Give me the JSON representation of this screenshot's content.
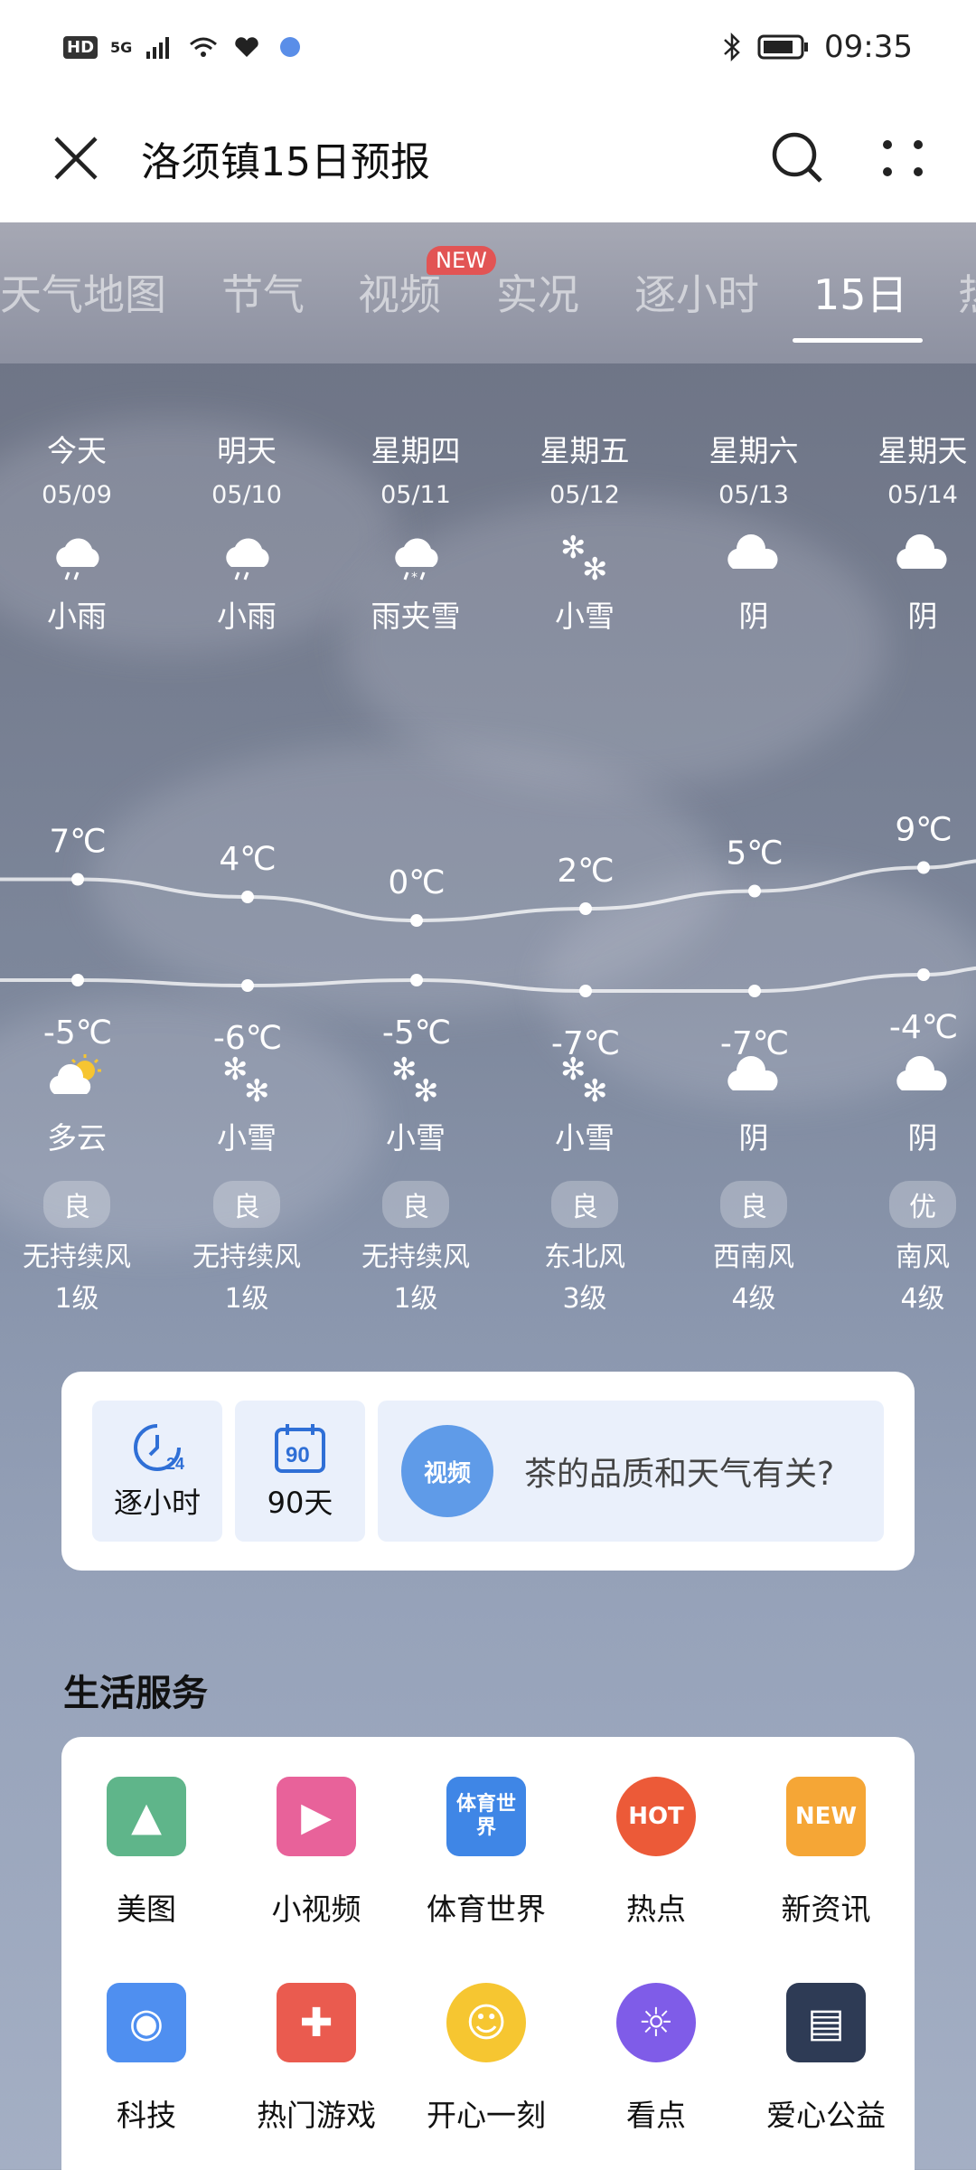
{
  "status": {
    "time": "09:35",
    "hd": "HD",
    "net": "5G"
  },
  "header": {
    "title": "洛须镇15日预报"
  },
  "tabs": [
    {
      "label": "天气地图"
    },
    {
      "label": "节气"
    },
    {
      "label": "视频",
      "badge": "NEW"
    },
    {
      "label": "实况"
    },
    {
      "label": "逐小时"
    },
    {
      "label": "15日"
    },
    {
      "label": "热"
    }
  ],
  "days": [
    {
      "day": "今天",
      "date": "05/09",
      "day_weather": "小雨",
      "day_icon": "light-rain",
      "high": "7℃",
      "low": "-5℃",
      "night_weather": "多云",
      "night_icon": "partly-cloudy",
      "aqi": "良",
      "wind": "无持续风",
      "wind_level": "1级"
    },
    {
      "day": "明天",
      "date": "05/10",
      "day_weather": "小雨",
      "day_icon": "light-rain",
      "high": "4℃",
      "low": "-6℃",
      "night_weather": "小雪",
      "night_icon": "light-snow",
      "aqi": "良",
      "wind": "无持续风",
      "wind_level": "1级"
    },
    {
      "day": "星期四",
      "date": "05/11",
      "day_weather": "雨夹雪",
      "day_icon": "sleet",
      "high": "0℃",
      "low": "-5℃",
      "night_weather": "小雪",
      "night_icon": "light-snow",
      "aqi": "良",
      "wind": "无持续风",
      "wind_level": "1级"
    },
    {
      "day": "星期五",
      "date": "05/12",
      "day_weather": "小雪",
      "day_icon": "light-snow",
      "high": "2℃",
      "low": "-7℃",
      "night_weather": "小雪",
      "night_icon": "light-snow",
      "aqi": "良",
      "wind": "东北风",
      "wind_level": "3级"
    },
    {
      "day": "星期六",
      "date": "05/13",
      "day_weather": "阴",
      "day_icon": "overcast",
      "high": "5℃",
      "low": "-7℃",
      "night_weather": "阴",
      "night_icon": "overcast",
      "aqi": "良",
      "wind": "西南风",
      "wind_level": "4级"
    },
    {
      "day": "星期天",
      "date": "05/14",
      "day_weather": "阴",
      "day_icon": "overcast",
      "high": "9℃",
      "low": "-4℃",
      "night_weather": "阴",
      "night_icon": "overcast",
      "aqi": "优",
      "wind": "南风",
      "wind_level": "4级"
    }
  ],
  "quick": {
    "hourly_label": "逐小时",
    "hourly_icon_text": "24",
    "days90_label": "90天",
    "days90_icon_text": "90",
    "promo_badge": "视频",
    "promo_text": "茶的品质和天气有关?"
  },
  "services": {
    "title": "生活服务",
    "items": [
      {
        "label": "美图",
        "icon": "picture-icon",
        "color": "#5fb58a"
      },
      {
        "label": "小视频",
        "icon": "video-icon",
        "color": "#e8629a"
      },
      {
        "label": "体育世界",
        "icon": "sports-icon",
        "color": "#3f86e6",
        "icon_text": "体育世界"
      },
      {
        "label": "热点",
        "icon": "hot-icon",
        "color": "#ec5a38",
        "icon_text": "HOT"
      },
      {
        "label": "新资讯",
        "icon": "news-icon",
        "color": "#f5a636",
        "icon_text": "NEW"
      },
      {
        "label": "科技",
        "icon": "robot-icon",
        "color": "#4f8ff0"
      },
      {
        "label": "热门游戏",
        "icon": "gamepad-icon",
        "color": "#ea5b4f"
      },
      {
        "label": "开心一刻",
        "icon": "smile-icon",
        "color": "#f6c631"
      },
      {
        "label": "看点",
        "icon": "bulb-icon",
        "color": "#7f5ce8"
      },
      {
        "label": "爱心公益",
        "icon": "book-icon",
        "color": "#2e3b55"
      }
    ]
  }
}
